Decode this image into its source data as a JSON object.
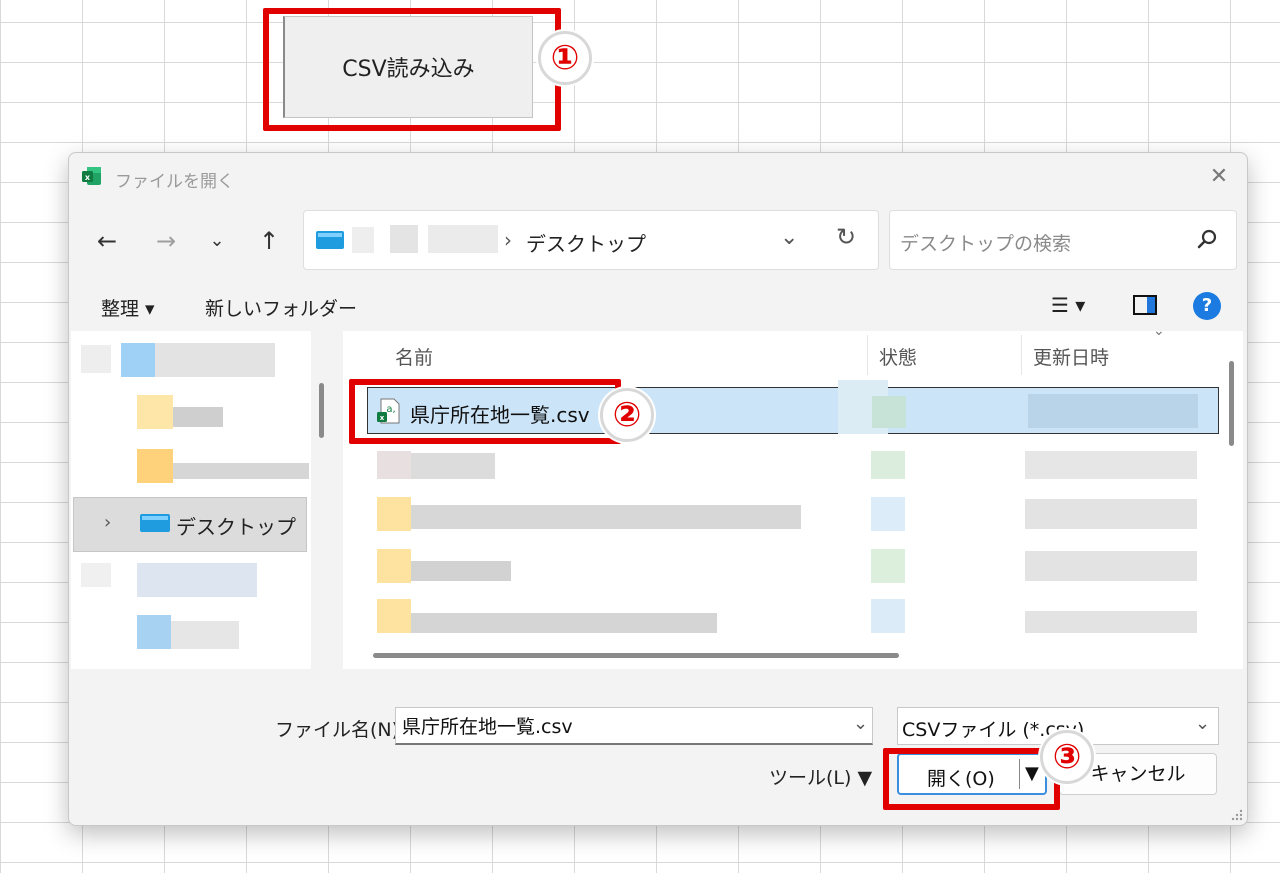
{
  "sheet": {
    "button_label": "CSV読み込み"
  },
  "annotations": {
    "step1": "①",
    "step2": "②",
    "step3": "③",
    "highlight_color": "#e00000"
  },
  "dialog": {
    "title": "ファイルを開く",
    "close_icon": "close-icon",
    "nav": {
      "back": "←",
      "forward": "→",
      "recent": "⌄",
      "up": "↑"
    },
    "address": {
      "separator": "›",
      "current": "デスクトップ",
      "dropdown": "⌄",
      "refresh": "↻"
    },
    "search": {
      "placeholder": "デスクトップの検索"
    },
    "toolbar": {
      "organize": "整理 ▾",
      "new_folder": "新しいフォルダー",
      "view": "☰ ▾",
      "help": "?"
    },
    "nav_pane": {
      "selected_item": "デスクトップ",
      "chevron": "›"
    },
    "file_list": {
      "columns": [
        "名前",
        "状態",
        "更新日時"
      ],
      "sort_indicator": "⌄",
      "selected_file": "県庁所在地一覧.csv"
    },
    "footer": {
      "filename_label": "ファイル名(N):",
      "filename_value": "県庁所在地一覧.csv",
      "filetype": "CSVファイル (*.csv)",
      "dropdown": "⌄",
      "tools": "ツール(L)  ▼",
      "open": "開く(O)",
      "open_arrow": "▼",
      "cancel": "キャンセル"
    },
    "accent_color": "#1b7be0",
    "selection_color": "#cce4f7"
  }
}
